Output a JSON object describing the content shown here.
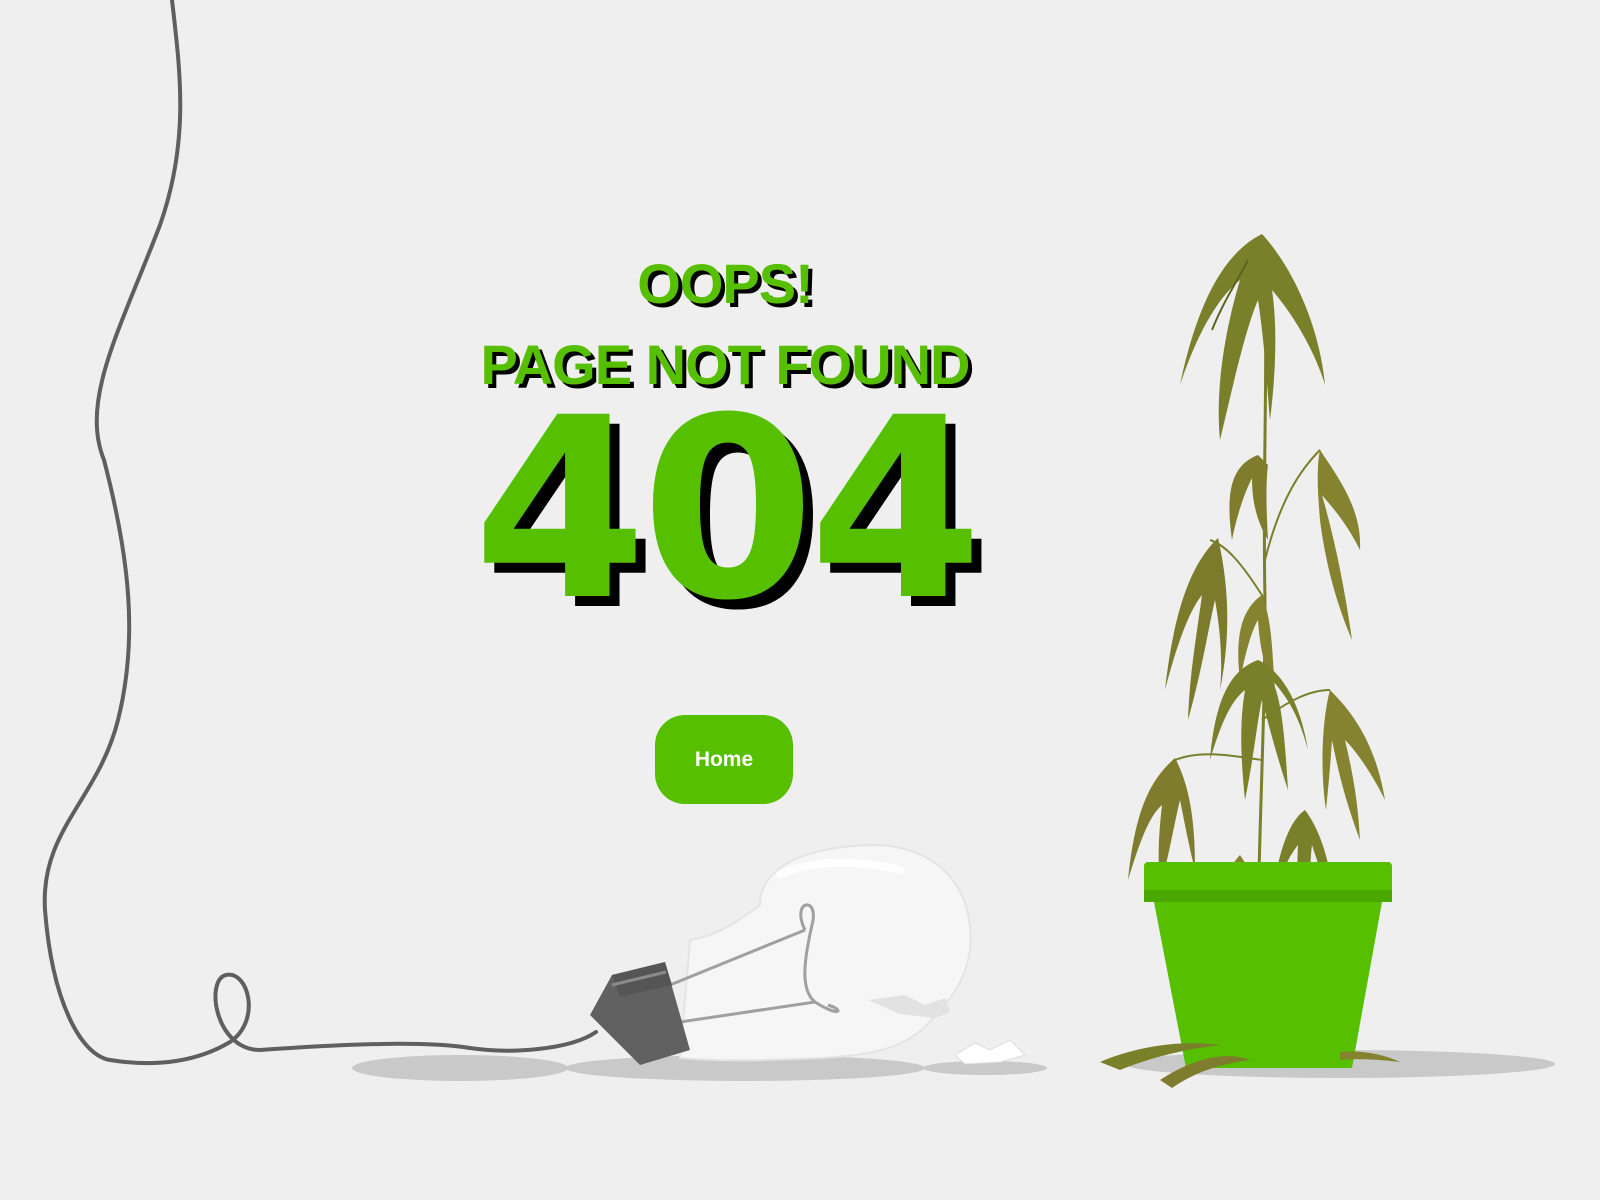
{
  "error": {
    "line1": "OOPS!",
    "line2": "PAGE NOT FOUND",
    "code": "404"
  },
  "actions": {
    "home_label": "Home"
  },
  "illustrations": {
    "cord": "hanging-cord-icon",
    "bulb": "broken-light-bulb-icon",
    "plant": "wilted-potted-plant-icon"
  },
  "colors": {
    "background": "#efefef",
    "accent_green": "#55bf00",
    "text_shadow": "#000000",
    "leaf": "#7a7f2a",
    "cord": "#5f5f5f"
  }
}
